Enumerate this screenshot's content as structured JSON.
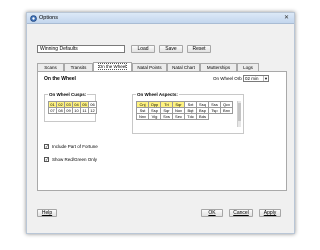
{
  "window": {
    "title": "Options"
  },
  "preset": {
    "value": "Winning Defaults",
    "load_label": "Load",
    "save_label": "Save",
    "reset_label": "Reset"
  },
  "tabs": [
    {
      "label": "Scans"
    },
    {
      "label": "Transits"
    },
    {
      "label": "On the Wheel",
      "active": true
    },
    {
      "label": "Natal Points"
    },
    {
      "label": "Natal Chart"
    },
    {
      "label": "Mutterships"
    },
    {
      "label": "Logs"
    }
  ],
  "panel": {
    "title": "On the Wheel",
    "orb_label": "On Wheel Orb",
    "orb_value": "02 min",
    "cusps": {
      "title": "On Wheel Cusps:",
      "cells": [
        "01",
        "02",
        "03",
        "04",
        "05",
        "06",
        "07",
        "08",
        "09",
        "10",
        "11",
        "12"
      ],
      "selected": [
        0,
        1,
        2,
        3,
        4
      ]
    },
    "aspects": {
      "title": "On Wheel Aspects:",
      "cells": [
        "Cnj",
        "Opp",
        "Tri",
        "Sqr",
        "Sxt",
        "Ssq",
        "Sss",
        "Qcx",
        "Sst",
        "Ssp",
        "Sqr",
        "Nov",
        "Bqt",
        "Bsp",
        "Tsp",
        "Bnv",
        "Nnv",
        "Vig",
        "Sxs",
        "Sec",
        "Tdc",
        "Bds"
      ],
      "selected": [
        0,
        1,
        2,
        3
      ]
    },
    "checkboxes": [
      {
        "label": "Include Part of Fortune",
        "checked": true
      },
      {
        "label": "Show Red/Green Only",
        "checked": true
      }
    ]
  },
  "footer": {
    "help_label": "Help",
    "ok_label": "OK",
    "cancel_label": "Cancel",
    "apply_label": "Apply"
  },
  "colors": {
    "selected_cell": "#fff380",
    "titlebar": "#c3d6ee"
  }
}
